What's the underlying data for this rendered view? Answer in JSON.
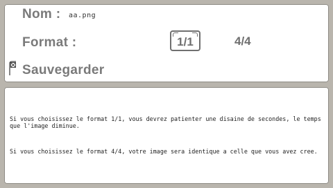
{
  "form": {
    "name_label": "Nom :",
    "filename": "aa.png",
    "format_label": "Format :",
    "format_options": [
      {
        "label": "1/1",
        "selected": true
      },
      {
        "label": "4/4",
        "selected": false
      }
    ],
    "save_label": "Sauvegarder",
    "save_checked": true
  },
  "help": {
    "paragraphs": [
      "Si vous choisissez le format 1/1, vous devrez patienter une disaine de secondes, le temps que l'image diminue.",
      "Si vous choisissez le format 4/4, votre image sera identique a celle que vous avez cree."
    ]
  },
  "colors": {
    "background": "#b9b5ad",
    "panel": "#ffffff",
    "label_text": "#7a7a7a"
  }
}
